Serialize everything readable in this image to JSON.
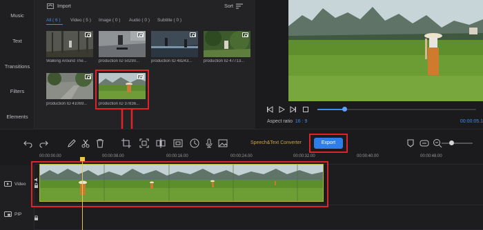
{
  "sidebar": {
    "items": [
      {
        "label": "Music"
      },
      {
        "label": "Text"
      },
      {
        "label": "Transitions"
      },
      {
        "label": "Filters"
      },
      {
        "label": "Elements"
      }
    ]
  },
  "library": {
    "import_label": "Import",
    "sort_label": "Sort",
    "filters": [
      {
        "label": "All ( 6 )"
      },
      {
        "label": "Video ( 5 )"
      },
      {
        "label": "Image ( 0 )"
      },
      {
        "label": "Audio ( 0 )"
      },
      {
        "label": "Subtitle ( 0 )"
      }
    ],
    "items": [
      {
        "caption": "Walking Around The..."
      },
      {
        "caption": "production ID 50290..."
      },
      {
        "caption": "production ID 48243..."
      },
      {
        "caption": "production ID 47713..."
      },
      {
        "caption": "production ID 41069..."
      },
      {
        "caption": "production ID 37836..."
      }
    ]
  },
  "preview": {
    "aspect_label": "Aspect ratio",
    "aspect_value": "16 : 9",
    "time": "00:00:05.1",
    "progress": 0.17
  },
  "toolbar": {
    "speech_text": "Speech&Text Converter",
    "export_label": "Export",
    "icons": [
      "undo-icon",
      "redo-icon",
      "pen-icon",
      "scissors-icon",
      "delete-icon",
      "crop-icon",
      "screenshot-icon",
      "split-icon",
      "freeze-frame-icon",
      "speed-icon",
      "record-voice-icon",
      "image-icon"
    ]
  },
  "timeline": {
    "ruler": [
      "00:00:00.00",
      "00:00:08.00",
      "00:00:16.00",
      "00:00:24.00",
      "00:00:32.00",
      "00:00:40.00",
      "00:00:48.00"
    ],
    "tracks": [
      {
        "label": "Video"
      },
      {
        "label": "PIP"
      }
    ]
  },
  "colors": {
    "accent": "#3f8cf2",
    "highlight": "#e0242a",
    "playhead": "#e9c54a"
  }
}
